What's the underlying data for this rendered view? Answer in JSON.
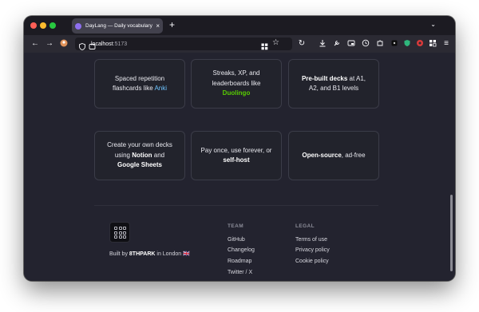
{
  "browser": {
    "tab_title": "DayLang — Daily vocabulary bu",
    "tab_close": "×",
    "new_tab": "+",
    "tab_list": "⌄",
    "url_host": "localhost",
    "url_port": ":5173"
  },
  "features": [
    {
      "pre": "Spaced repetition flashcards like ",
      "accent": "Anki",
      "post": ""
    },
    {
      "pre": "Streaks, XP, and leaderboards like ",
      "accent": "Duolingo",
      "post": ""
    },
    {
      "pre": "",
      "strong": "Pre-built decks",
      "post": " at A1, A2, and B1 levels"
    },
    {
      "pre": "Create your own decks using ",
      "strong": "Notion",
      "mid": " and ",
      "strong2": "Google Sheets",
      "post": ""
    },
    {
      "pre": "Pay once, use forever, or ",
      "strong": "self-host",
      "post": ""
    },
    {
      "pre": "",
      "strong": "Open-source",
      "post": ", ad-free"
    }
  ],
  "footer": {
    "built_by_pre": "Built by ",
    "built_by_brand": "8THPARK",
    "built_by_post": " in London 🇬🇧",
    "team_title": "TEAM",
    "team_links": [
      "GitHub",
      "Changelog",
      "Roadmap",
      "Twitter / X"
    ],
    "legal_title": "LEGAL",
    "legal_links": [
      "Terms of use",
      "Privacy policy",
      "Cookie policy"
    ]
  },
  "colors": {
    "accent_anki": "#6ec3ff",
    "accent_duolingo": "#58cc02",
    "page_bg": "#23232f"
  }
}
